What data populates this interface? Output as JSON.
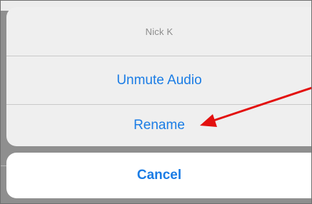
{
  "action_sheet": {
    "title": "Nick K",
    "actions": [
      {
        "label": "Unmute Audio"
      },
      {
        "label": "Rename"
      }
    ],
    "cancel_label": "Cancel"
  },
  "annotation": {
    "arrow_color": "#e3100e"
  },
  "colors": {
    "accent": "#1a7ce5",
    "sheet_background": "#efefef",
    "cancel_background": "#ffffff",
    "title_text": "#8c8c8c"
  }
}
